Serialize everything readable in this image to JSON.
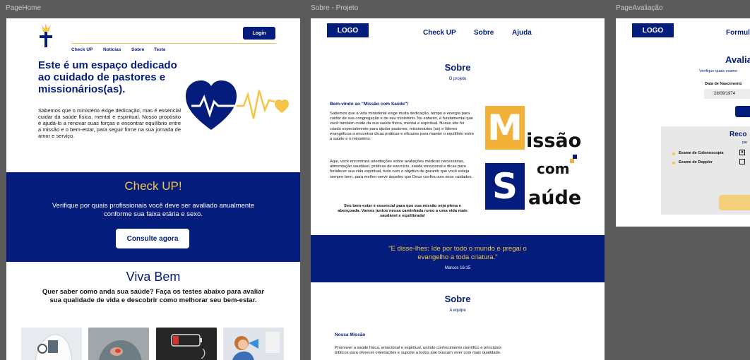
{
  "frames": {
    "home": "PageHome",
    "sobre": "Sobre - Projeto",
    "avaliacao": "PageAvaliação"
  },
  "home": {
    "login": "Login",
    "nav": [
      "Check UP",
      "Notícias",
      "Sobre",
      "Teste"
    ],
    "hero_title": "Este é um espaço dedicado ao cuidado de pastores e missionários(as).",
    "hero_text": "Sabemos que o ministério exige dedicação, mas é essencial cuidar da saúde física, mental e espiritual. Nosso propósito é ajudá-lo a renovar suas forças e encontrar equilíbrio entre a missão e o bem-estar, para seguir firme na sua jornada de amor e serviço.",
    "checkup_title": "Check UP!",
    "checkup_text": "Verifique por quais profissionais você deve ser avaliado anualmente conforme sua faixa etária e sexo.",
    "checkup_button": "Consulte agora",
    "viva_title": "Viva Bem",
    "viva_text": "Quer saber como anda sua saúde? Faça os testes abaixo para avaliar sua qualidade de vida e descobrir como melhorar seu bem-estar.",
    "colors": {
      "navy": "#041c7c",
      "gold": "#f5c54a"
    }
  },
  "sobre": {
    "logo": "LOGO",
    "nav": [
      "Check UP",
      "Sobre",
      "Ajuda"
    ],
    "title": "Sobre",
    "subtitle": "O projeto",
    "welcome": "Bem-vindo ao \"Missão com Saúde\"!",
    "p1": "Sabemos que a vida ministerial exige muita dedicação, tempo e energia para cuidar de sua congregação e de seu ministério. No entanto, é fundamental que você também cuide da sua saúde física, mental e espiritual. Nosso site foi criado especialmente para ajudar pastores, missionários (as) e líderes evangélicos a encontrar dicas práticas e eficazes para manter o equilíbrio entre a saúde e o ministério.",
    "p2": "Aqui, você encontrará orientações sobre avaliações médicas necessárias, alimentação saudável, práticas de exercício, saúde emocional e dicas para fortalecer sua vida espiritual, tudo com o objetivo de garantir que você esteja sempre bem, para melhor servir àqueles que Deus confiou aos seus cuidados.",
    "p3": "Seu bem-estar é essencial para que sua missão seja plena e abençoada. Vamos juntos nessa caminhada rumo a uma vida mais saudável e equilibrada!",
    "brand_m": "M",
    "brand_issao": "issão",
    "brand_com": "com",
    "brand_s": "S",
    "brand_aude": "aúde",
    "quote": "\"E disse-lhes: Ide por todo o mundo e pregai o evangelho a toda criatura.\"",
    "quote_ref": "Marcos 16:15",
    "title2": "Sobre",
    "subtitle2": "A equipe",
    "mission_title": "Nossa Missão",
    "mission_text": "Promover a saúde física, emocional e espiritual, unindo conhecimento científico e princípios bíblicos para oferecer orientações e suporte a todos que buscam viver com mais qualidade."
  },
  "avaliacao": {
    "logo": "LOGO",
    "nav": "Formul",
    "title": "Avalia",
    "subtitle": "Verifique quais exame",
    "birth_label": "Data de Nascimento",
    "birth_value": "28/09/1974",
    "reco_title": "Reco",
    "reco_sub": "par",
    "exams": [
      {
        "label": "Exame de Colonoscopia",
        "checked": "x"
      },
      {
        "label": "Exame de Doppler",
        "checked": ""
      }
    ]
  }
}
